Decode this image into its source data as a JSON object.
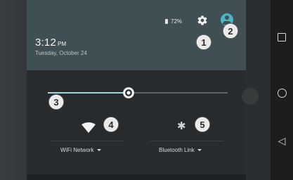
{
  "status": {
    "battery_text": "72%",
    "icons": [
      "battery-icon",
      "settings-icon",
      "avatar-icon"
    ]
  },
  "header": {
    "time": "3:12",
    "ampm": "PM",
    "date": "Tuesday, October 24"
  },
  "brightness": {
    "level_fraction": 0.45
  },
  "tiles": {
    "wifi": {
      "label": "WiFi Network",
      "icon": "wifi-icon"
    },
    "bluetooth": {
      "label": "Bluetooth Link",
      "icon": "bluetooth-icon"
    }
  },
  "callouts": [
    "1",
    "2",
    "3",
    "4",
    "5"
  ],
  "colors": {
    "header_bg": "#3f4f54",
    "panel_bg": "#272b2d",
    "accent": "#9fd5df"
  }
}
